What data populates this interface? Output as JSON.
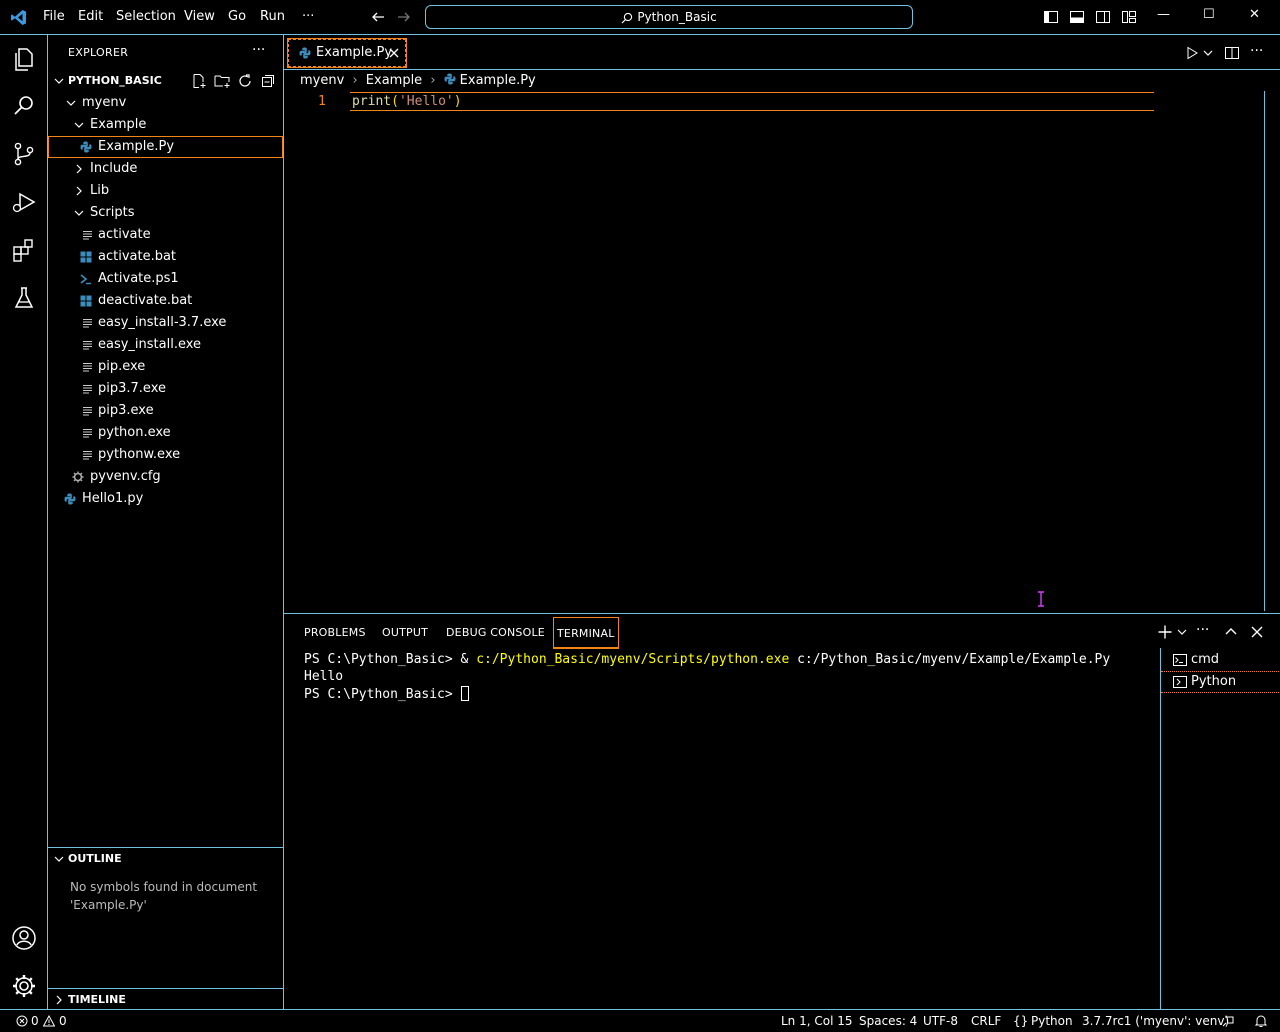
{
  "titlebar": {
    "menu": [
      "File",
      "Edit",
      "Selection",
      "View",
      "Go",
      "Run",
      "···"
    ],
    "search": "Python_Basic",
    "controls": {
      "minimize": "—",
      "maximize": "☐",
      "close": "✕"
    }
  },
  "sidebar": {
    "title": "EXPLORER",
    "more": "···",
    "root": "PYTHON_BASIC",
    "tree": [
      {
        "label": "myenv"
      },
      {
        "label": "Example"
      },
      {
        "label": "Example.Py"
      },
      {
        "label": "Include"
      },
      {
        "label": "Lib"
      },
      {
        "label": "Scripts"
      },
      {
        "label": "activate"
      },
      {
        "label": "activate.bat"
      },
      {
        "label": "Activate.ps1"
      },
      {
        "label": "deactivate.bat"
      },
      {
        "label": "easy_install-3.7.exe"
      },
      {
        "label": "easy_install.exe"
      },
      {
        "label": "pip.exe"
      },
      {
        "label": "pip3.7.exe"
      },
      {
        "label": "pip3.exe"
      },
      {
        "label": "python.exe"
      },
      {
        "label": "pythonw.exe"
      },
      {
        "label": "pyvenv.cfg"
      },
      {
        "label": "Hello1.py"
      }
    ],
    "outline": {
      "title": "OUTLINE",
      "message": "No symbols found in document 'Example.Py'"
    },
    "timeline": {
      "title": "TIMELINE"
    }
  },
  "editor": {
    "tab": "Example.Py",
    "breadcrumb": [
      "myenv",
      "Example",
      "Example.Py"
    ],
    "line_number": "1",
    "code": {
      "fn": "print",
      "open": "(",
      "str": "'Hello'",
      "close": ")"
    }
  },
  "panel": {
    "tabs": [
      "PROBLEMS",
      "OUTPUT",
      "DEBUG CONSOLE",
      "TERMINAL"
    ],
    "active_tab": "TERMINAL",
    "terminal": {
      "prompt": "PS C:\\Python_Basic> ",
      "amp": "& ",
      "exe": "c:/Python_Basic/myenv/Scripts/python.exe",
      "arg": " c:/Python_Basic/myenv/Example/Example.Py",
      "output": "Hello",
      "prompt2": "PS C:\\Python_Basic> "
    },
    "terminals": [
      "cmd",
      "Python"
    ]
  },
  "statusbar": {
    "errors": "0",
    "warnings": "0",
    "position": "Ln 1, Col 15",
    "spaces": "Spaces: 4",
    "encoding": "UTF-8",
    "eol": "CRLF",
    "language": "Python",
    "interpreter": "3.7.7rc1 ('myenv': venv)"
  },
  "colors": {
    "accent_border": "#6fc3df",
    "focus_orange": "#f38518",
    "terminal_yellow": "#ffff00",
    "python_blue": "#3c8dbc"
  }
}
